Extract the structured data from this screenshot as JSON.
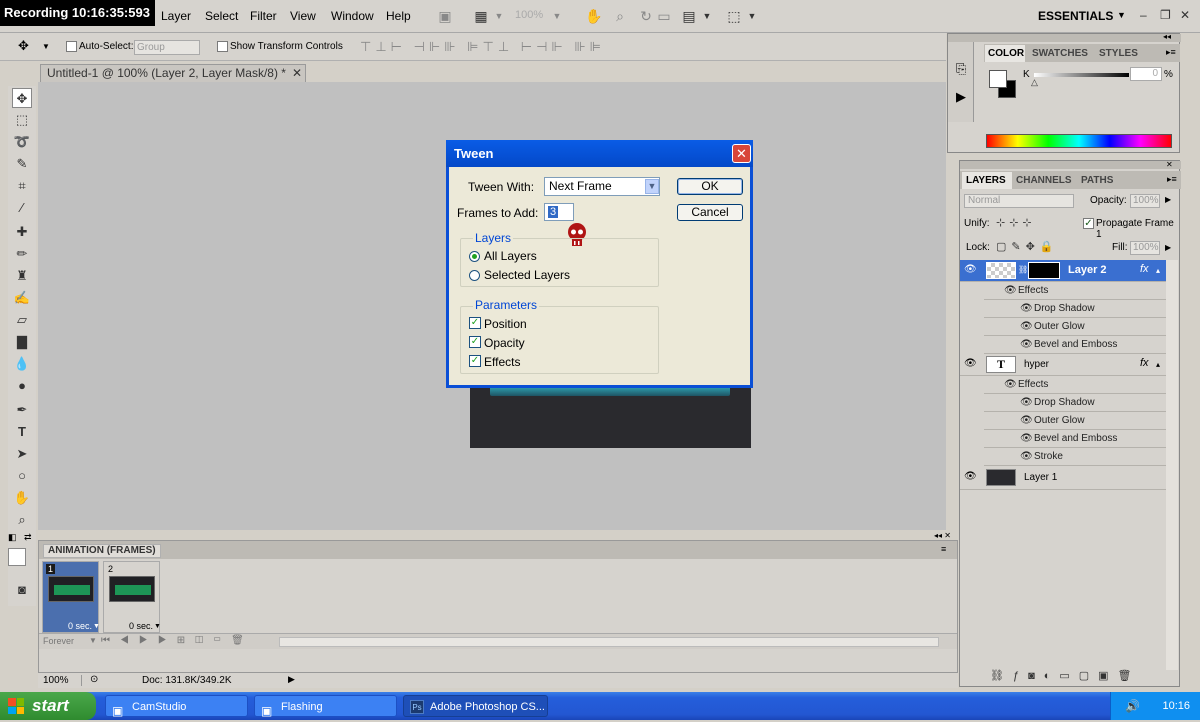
{
  "recording": "Recording 10:16:35:593",
  "menu": [
    "Layer",
    "Select",
    "Filter",
    "View",
    "Window",
    "Help"
  ],
  "toolbar": {
    "zoom": "100%",
    "workspace": "ESSENTIALS"
  },
  "options": {
    "auto_select": "Auto-Select:",
    "group": "Group",
    "show_transform": "Show Transform Controls"
  },
  "doc_tab": "Untitled-1 @ 100% (Layer 2, Layer Mask/8) *",
  "dialog": {
    "title": "Tween",
    "tween_with_label": "Tween With:",
    "tween_with_value": "Next Frame",
    "frames_label": "Frames to Add:",
    "frames_value": "3",
    "ok": "OK",
    "cancel": "Cancel",
    "layers_legend": "Layers",
    "all_layers": "All Layers",
    "selected_layers": "Selected Layers",
    "params_legend": "Parameters",
    "position": "Position",
    "opacity": "Opacity",
    "effects": "Effects"
  },
  "color_panel": {
    "tabs": [
      "COLOR",
      "SWATCHES",
      "STYLES"
    ],
    "channel": "K",
    "value": "0",
    "unit": "%"
  },
  "layers_panel": {
    "tabs": [
      "LAYERS",
      "CHANNELS",
      "PATHS"
    ],
    "blend": "Normal",
    "opacity_label": "Opacity:",
    "opacity_value": "100%",
    "unify": "Unify:",
    "propagate": "Propagate Frame 1",
    "lock": "Lock:",
    "fill_label": "Fill:",
    "fill_value": "100%",
    "layer2": "Layer 2",
    "hyper": "hyper",
    "layer1": "Layer 1",
    "effects": "Effects",
    "drop_shadow": "Drop Shadow",
    "outer_glow": "Outer Glow",
    "bevel": "Bevel and Emboss",
    "stroke": "Stroke"
  },
  "animation": {
    "title": "ANIMATION (FRAMES)",
    "frames": [
      {
        "num": "1",
        "delay": "0 sec."
      },
      {
        "num": "2",
        "delay": "0 sec."
      }
    ],
    "loop": "Forever"
  },
  "status": {
    "zoom": "100%",
    "doc": "Doc: 131.8K/349.2K"
  },
  "taskbar": {
    "start": "start",
    "tasks": [
      "CamStudio",
      "Flashing",
      "Adobe Photoshop CS..."
    ],
    "time": "10:16"
  }
}
